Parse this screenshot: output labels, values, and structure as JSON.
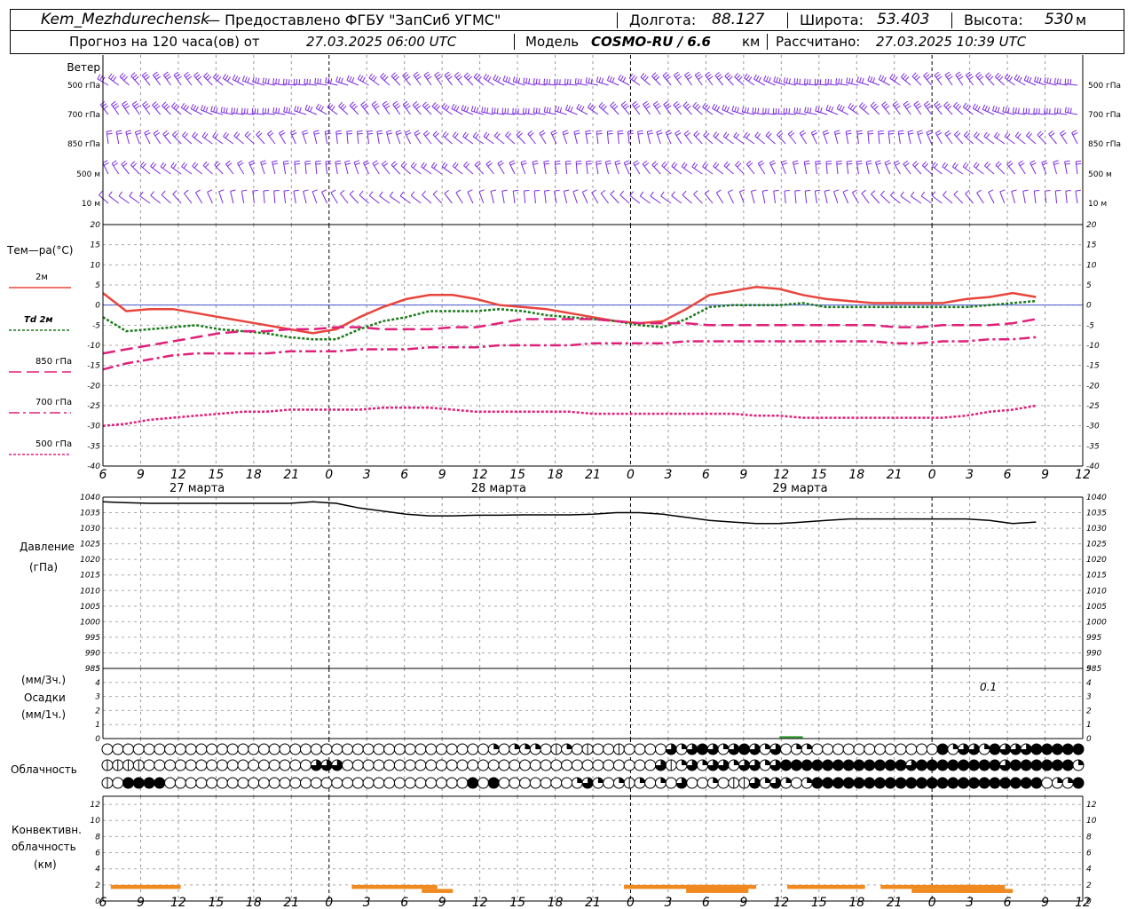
{
  "header": {
    "station": "Kem_Mezhdurechensk",
    "provider": "— Предоставлено ФГБУ \"ЗапСиб УГМС\"",
    "lon_label": "Долгота:",
    "lon_value": "88.127",
    "lat_label": "Широта:",
    "lat_value": "53.403",
    "alt_label": "Высота:",
    "alt_value": "530",
    "alt_unit": "м",
    "forecast_label": "Прогноз на 120 часа(ов) от",
    "forecast_start": "27.03.2025 06:00 UTC",
    "model_label": "Модель",
    "model_name": "COSMO-RU / 6.6",
    "model_unit": "км",
    "computed_label": "Рассчитано:",
    "computed_time": "27.03.2025 10:39 UTC"
  },
  "labels": {
    "wind": "Ветер",
    "temp": "Тем—ра(°С)",
    "pressure_1": "Давление",
    "pressure_2": "(гПа)",
    "precip_1": "(мм/3ч.)",
    "precip_2": "Осадки",
    "precip_3": "(мм/1ч.)",
    "cloud": "Облачность",
    "conv_1": "Конвективн.",
    "conv_2": "облачность",
    "conv_3": "(км)",
    "precip_note": "0.1"
  },
  "colors": {
    "t2m": "#e8453c",
    "td2m": "#1a7a1a",
    "t850": "#e0207a",
    "t700": "#e0207a",
    "t500": "#e0207a",
    "wind": "#7a2be0",
    "pressure": "#000000",
    "precip": "#2a9a2a",
    "conv": "#f08a20",
    "zero_line": "#4a5ad0"
  },
  "time_axis": {
    "ticks": [
      "6",
      "9",
      "12",
      "15",
      "18",
      "21",
      "0",
      "3",
      "6",
      "9",
      "12",
      "15",
      "18",
      "21",
      "0",
      "3",
      "6",
      "9",
      "12",
      "15",
      "18",
      "21",
      "0",
      "3",
      "6",
      "9",
      "12"
    ],
    "dates": [
      "27 марта",
      "28 марта",
      "29 марта"
    ]
  },
  "wind_levels": [
    "500 гПа",
    "700 гПа",
    "850 гПа",
    "500 м",
    "10 м"
  ],
  "chart_data": [
    {
      "type": "line",
      "title": "Тем—ра(°С)",
      "ylim": [
        -40,
        20
      ],
      "yticks": [
        20,
        15,
        10,
        5,
        0,
        -5,
        -10,
        -15,
        -20,
        -25,
        -30,
        -35,
        -40
      ],
      "x": [
        0,
        3,
        6,
        9,
        12,
        15,
        18,
        21,
        24,
        27,
        30,
        33,
        36,
        39,
        42,
        45,
        48,
        51,
        54,
        57,
        60,
        63,
        66,
        69,
        72,
        75,
        78,
        81,
        84,
        87,
        90,
        93,
        96,
        99,
        102,
        105,
        108,
        111,
        114,
        117,
        120
      ],
      "series": [
        {
          "name": "2м",
          "values": [
            3,
            -1.5,
            -1,
            -1,
            -2,
            -3,
            -4,
            -5,
            -6,
            -7,
            -6,
            -3,
            -0.5,
            1.5,
            2.5,
            2.5,
            1.5,
            0,
            -0.5,
            -1,
            -2,
            -3,
            -4,
            -4.5,
            -4,
            -1,
            2.5,
            3.5,
            4.5,
            4,
            2.5,
            1.5,
            1,
            0.5,
            0.5,
            0.5,
            0.5,
            1.5,
            2,
            3,
            2
          ]
        },
        {
          "name": "Td 2м",
          "values": [
            -3,
            -6.5,
            -6,
            -5.5,
            -5,
            -6,
            -6.5,
            -7,
            -8,
            -8.5,
            -8.5,
            -6,
            -4,
            -3,
            -1.5,
            -1.5,
            -1.5,
            -1,
            -1.5,
            -2.5,
            -3,
            -3.5,
            -4,
            -5,
            -5.5,
            -3.5,
            -0.5,
            0,
            0,
            0,
            0.5,
            -0.5,
            -0.5,
            -0.5,
            -0.5,
            -0.5,
            -0.5,
            -0.5,
            0,
            0.5,
            1
          ]
        },
        {
          "name": "850 гПа",
          "values": [
            -12,
            -11,
            -10,
            -9,
            -8,
            -7,
            -6.5,
            -6.5,
            -6,
            -6,
            -5.5,
            -5.5,
            -6,
            -6,
            -6,
            -5.5,
            -5.5,
            -4.5,
            -3.5,
            -3.5,
            -3.5,
            -3.5,
            -4,
            -4.5,
            -4.5,
            -4.5,
            -5,
            -5,
            -5,
            -5,
            -5,
            -5,
            -5,
            -5,
            -5.5,
            -5.5,
            -5,
            -5,
            -5,
            -4.5,
            -3.5
          ]
        },
        {
          "name": "700 гПа",
          "values": [
            -16,
            -14.5,
            -13.5,
            -12.5,
            -12,
            -12,
            -12,
            -12,
            -11.5,
            -11.5,
            -11.5,
            -11,
            -11,
            -11,
            -10.5,
            -10.5,
            -10.5,
            -10,
            -10,
            -10,
            -10,
            -9.5,
            -9.5,
            -9.5,
            -9.5,
            -9,
            -9,
            -9,
            -9,
            -9,
            -9,
            -9,
            -9,
            -9,
            -9.5,
            -9.5,
            -9,
            -9,
            -8.5,
            -8.5,
            -8
          ]
        },
        {
          "name": "500 гПа",
          "values": [
            -30,
            -29.5,
            -28.5,
            -28,
            -27.5,
            -27,
            -26.5,
            -26.5,
            -26,
            -26,
            -26,
            -26,
            -25.5,
            -25.5,
            -25.5,
            -26,
            -26.5,
            -26.5,
            -26.5,
            -26.5,
            -26.5,
            -27,
            -27,
            -27,
            -27,
            -27,
            -27,
            -27,
            -27.5,
            -27.5,
            -28,
            -28,
            -28,
            -28,
            -28,
            -28,
            -28,
            -27.5,
            -26.5,
            -26,
            -25
          ]
        }
      ]
    },
    {
      "type": "line",
      "title": "Давление",
      "ylabel": "(гПа)",
      "ylim": [
        985,
        1040
      ],
      "yticks": [
        1040,
        1035,
        1030,
        1025,
        1020,
        1015,
        1010,
        1005,
        1000,
        995,
        990,
        985
      ],
      "x": [
        0,
        3,
        6,
        9,
        12,
        15,
        18,
        21,
        24,
        27,
        30,
        33,
        36,
        39,
        42,
        45,
        48,
        51,
        54,
        57,
        60,
        63,
        66,
        69,
        72,
        75,
        78,
        81,
        84,
        87,
        90,
        93,
        96,
        99,
        102,
        105,
        108,
        111,
        114,
        117,
        120
      ],
      "series": [
        {
          "values": [
            1038.5,
            1038.2,
            1038,
            1038,
            1038,
            1038,
            1038,
            1038,
            1038,
            1038.5,
            1038,
            1036.5,
            1035.5,
            1034.5,
            1034,
            1034,
            1034.2,
            1034.2,
            1034.3,
            1034.3,
            1034.3,
            1034.5,
            1035,
            1035,
            1034.5,
            1033.5,
            1032.5,
            1032,
            1031.5,
            1031.5,
            1032,
            1032.5,
            1033,
            1033,
            1033,
            1033,
            1033,
            1033,
            1032.5,
            1031.5,
            1032
          ]
        }
      ]
    },
    {
      "type": "bar",
      "title": "Осадки",
      "ylim": [
        0,
        5
      ],
      "yticks": [
        5,
        4,
        3,
        2,
        1,
        0
      ],
      "annotation": "0.1",
      "series": [
        {
          "name": "Осадки",
          "x_start": 87,
          "x_end": 90,
          "value": 0.1
        }
      ]
    },
    {
      "type": "bar",
      "title": "Конвективн. облачность",
      "ylabel": "(км)",
      "ylim": [
        0,
        13
      ],
      "yticks": [
        12,
        10,
        8,
        6,
        4,
        2,
        0
      ],
      "segments": [
        {
          "start": 1,
          "end": 10,
          "base": 1.5,
          "top": 2
        },
        {
          "start": 32,
          "end": 43,
          "base": 1.5,
          "top": 2
        },
        {
          "start": 41,
          "end": 45,
          "base": 1,
          "top": 1.5
        },
        {
          "start": 67,
          "end": 84,
          "base": 1.5,
          "top": 2
        },
        {
          "start": 75,
          "end": 83,
          "base": 1,
          "top": 2
        },
        {
          "start": 88,
          "end": 98,
          "base": 1.5,
          "top": 2
        },
        {
          "start": 100,
          "end": 112,
          "base": 1.5,
          "top": 2
        },
        {
          "start": 110,
          "end": 116,
          "base": 1,
          "top": 2
        },
        {
          "start": 104,
          "end": 117,
          "base": 1,
          "top": 1.5
        }
      ]
    }
  ],
  "cloud_cover": {
    "rows": [
      "0000000000000000000000000000000000000202220120100100003234323432302200000000000042332433344444",
      "1111000000000000000033300000000000000000000000000000031232332332344444444444434444444434444442",
      "1044440000000000000000000000000000040400000002320212020300201132320244444444444444444444440224"
    ]
  }
}
